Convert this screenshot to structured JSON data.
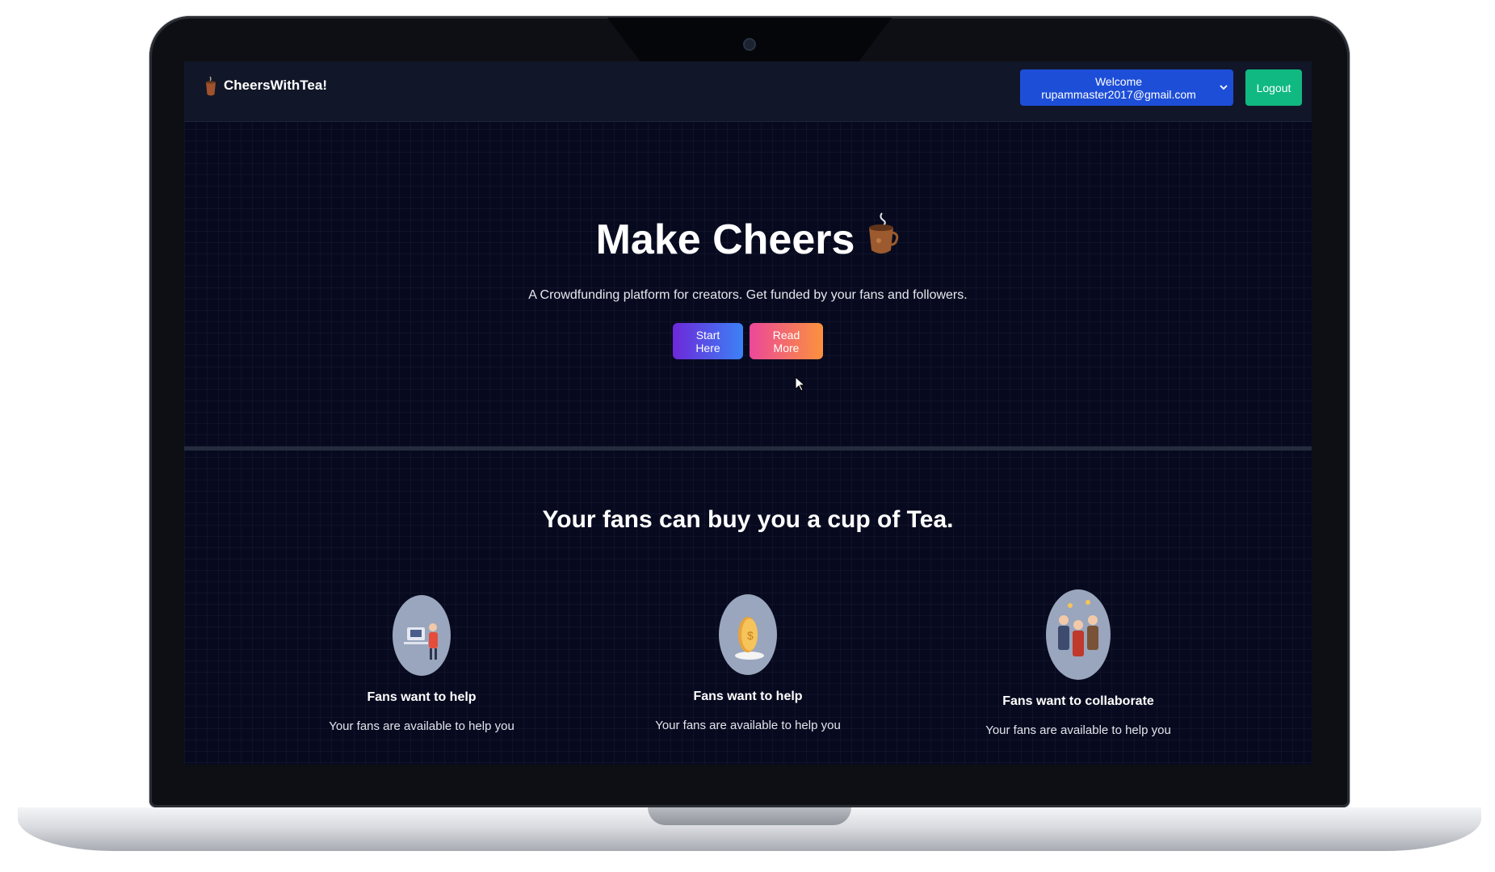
{
  "navbar": {
    "brand": "CheersWithTea!",
    "welcome": "Welcome rupammaster2017@gmail.com",
    "logout": "Logout"
  },
  "hero": {
    "title": "Make Cheers",
    "subtitle": "A Crowdfunding platform for creators. Get funded by your fans and followers.",
    "start_button": "Start Here",
    "read_button": "Read More"
  },
  "section": {
    "title": "Your fans can buy you a cup of Tea."
  },
  "features": [
    {
      "icon": "person-at-computer-icon",
      "title": "Fans want to help",
      "desc": "Your fans are available to help you"
    },
    {
      "icon": "coin-icon",
      "title": "Fans want to help",
      "desc": "Your fans are available to help you"
    },
    {
      "icon": "people-celebrating-icon",
      "title": "Fans want to collaborate",
      "desc": "Your fans are available to help you"
    }
  ],
  "colors": {
    "background": "#070a1f",
    "navbar": "#111728",
    "welcome_button": "#1d4ed8",
    "logout_button": "#10b981",
    "start_gradient": [
      "#6d28d9",
      "#3b82f6"
    ],
    "read_gradient": [
      "#ec4899",
      "#fb923c"
    ]
  }
}
